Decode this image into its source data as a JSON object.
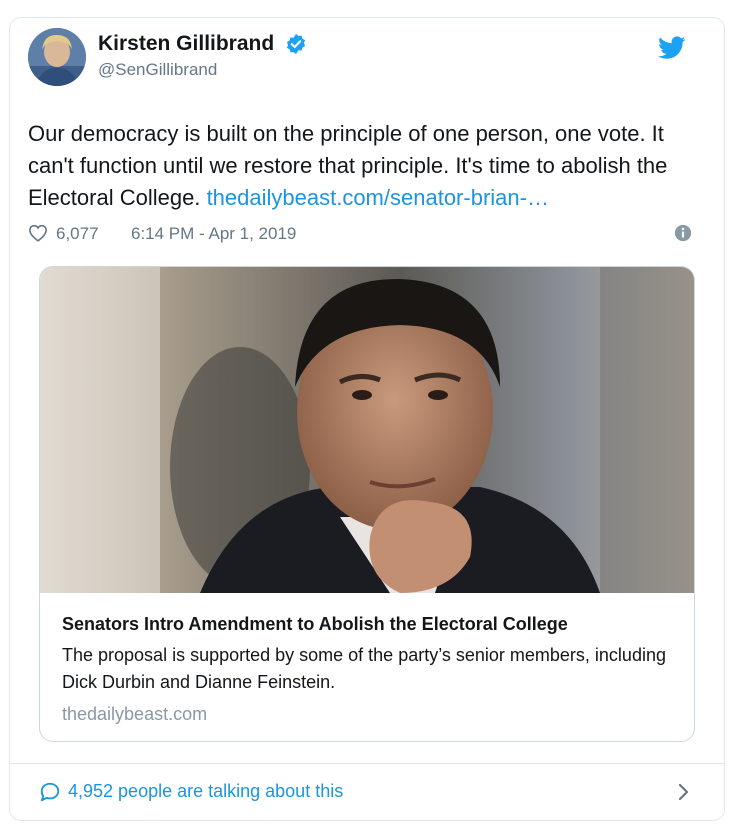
{
  "author": {
    "display_name": "Kirsten Gillibrand",
    "handle": "@SenGillibrand",
    "verified": true
  },
  "tweet": {
    "text": "Our democracy is built on the principle of one person, one vote. It can't function until we restore that principle. It's time to abolish the Electoral College.",
    "link": "thedailybeast.com/senator-brian-…",
    "likes": "6,077",
    "timestamp": "6:14 PM - Apr 1, 2019"
  },
  "card": {
    "title": "Senators Intro Amendment to Abolish the Electoral College",
    "description": "The proposal is supported by some of the party’s senior members, including Dick Durbin and Dianne Feinstein.",
    "domain": "thedailybeast.com"
  },
  "footer": {
    "talking": "4,952 people are talking about this"
  },
  "icons": {
    "verified": "verified-badge-icon",
    "twitter": "twitter-bird-icon",
    "like": "heart-icon",
    "info": "info-icon",
    "reply": "speech-bubble-icon",
    "chevron": "chevron-right-icon"
  },
  "colors": {
    "link": "#1b95e0",
    "secondary_text": "#657786",
    "border": "#e1e8ed",
    "twitter_blue": "#1da1f2"
  }
}
